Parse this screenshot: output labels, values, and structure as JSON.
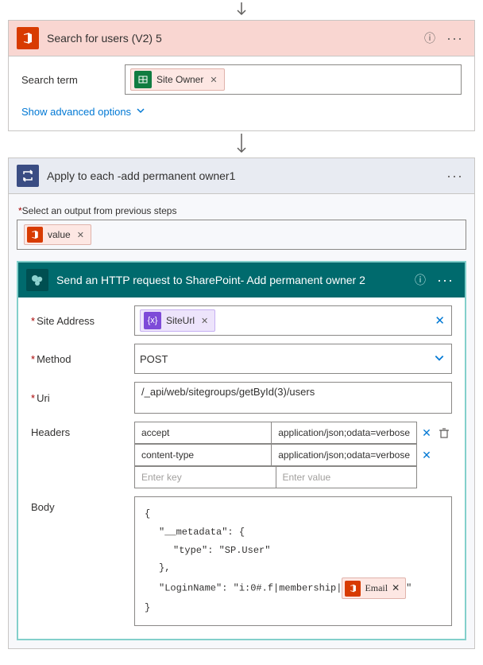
{
  "action1": {
    "title": "Search for users (V2) 5",
    "searchTermLabel": "Search term",
    "searchTermToken": "Site Owner",
    "advanced": "Show advanced options"
  },
  "action2": {
    "title": "Apply to each -add permanent owner1",
    "outputNote": "Select an output from previous steps",
    "outputToken": "value"
  },
  "action3": {
    "title": "Send an HTTP request to SharePoint- Add permanent owner 2",
    "siteAddressLabel": "Site Address",
    "siteAddressToken": "SiteUrl",
    "methodLabel": "Method",
    "methodValue": "POST",
    "uriLabel": "Uri",
    "uriValue": "/_api/web/sitegroups/getById(3)/users",
    "headersLabel": "Headers",
    "headers": [
      {
        "key": "accept",
        "value": "application/json;odata=verbose"
      },
      {
        "key": "content-type",
        "value": "application/json;odata=verbose"
      }
    ],
    "headerKeyPh": "Enter key",
    "headerValPh": "Enter value",
    "bodyLabel": "Body",
    "body": {
      "l1": "{",
      "l2": "\"__metadata\": {",
      "l3": "\"type\": \"SP.User\"",
      "l4": "},",
      "l5pre": "\"LoginName\": \"i:0#.f|membership|",
      "l5token": "Email",
      "l5post": "\"",
      "l6": "}"
    }
  }
}
